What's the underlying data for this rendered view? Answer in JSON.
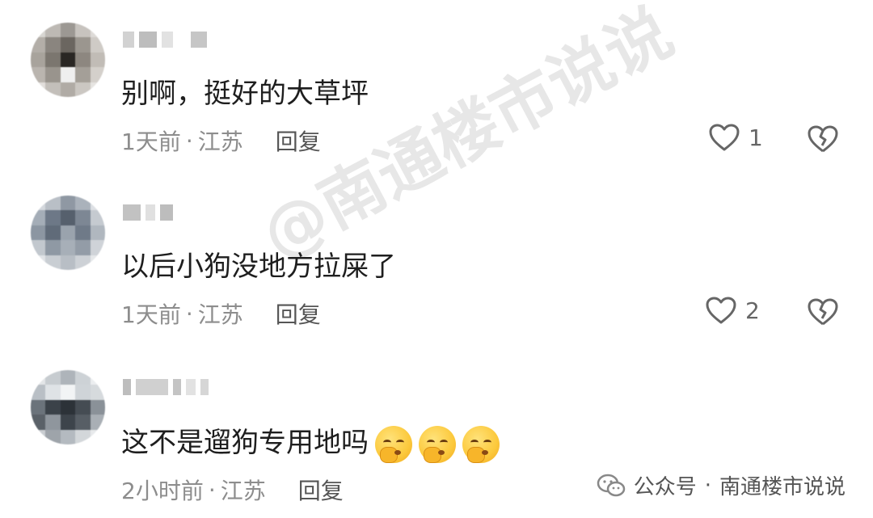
{
  "comments": [
    {
      "text": "别啊，挺好的大草坪",
      "time": "1天前",
      "location": "江苏",
      "separator": "·",
      "reply_label": "回复",
      "like_count": "1"
    },
    {
      "text": "以后小狗没地方拉屎了",
      "time": "1天前",
      "location": "江苏",
      "separator": "·",
      "reply_label": "回复",
      "like_count": "2"
    },
    {
      "text": "这不是遛狗专用地吗",
      "time": "2小时前",
      "location": "江苏",
      "separator": "·",
      "reply_label": "回复",
      "like_count": "",
      "emojis": [
        "face-with-hand-over-mouth-emoji",
        "face-with-hand-over-mouth-emoji",
        "face-with-hand-over-mouth-emoji"
      ]
    }
  ],
  "watermark": "@南通楼市说说",
  "footer": {
    "account_prefix": "公众号",
    "separator": "·",
    "account_name": "南通楼市说说",
    "icon": "wechat-icon"
  },
  "colors": {
    "text": "#1e1e1e",
    "meta": "#8d8d8d",
    "icon": "#666666"
  }
}
